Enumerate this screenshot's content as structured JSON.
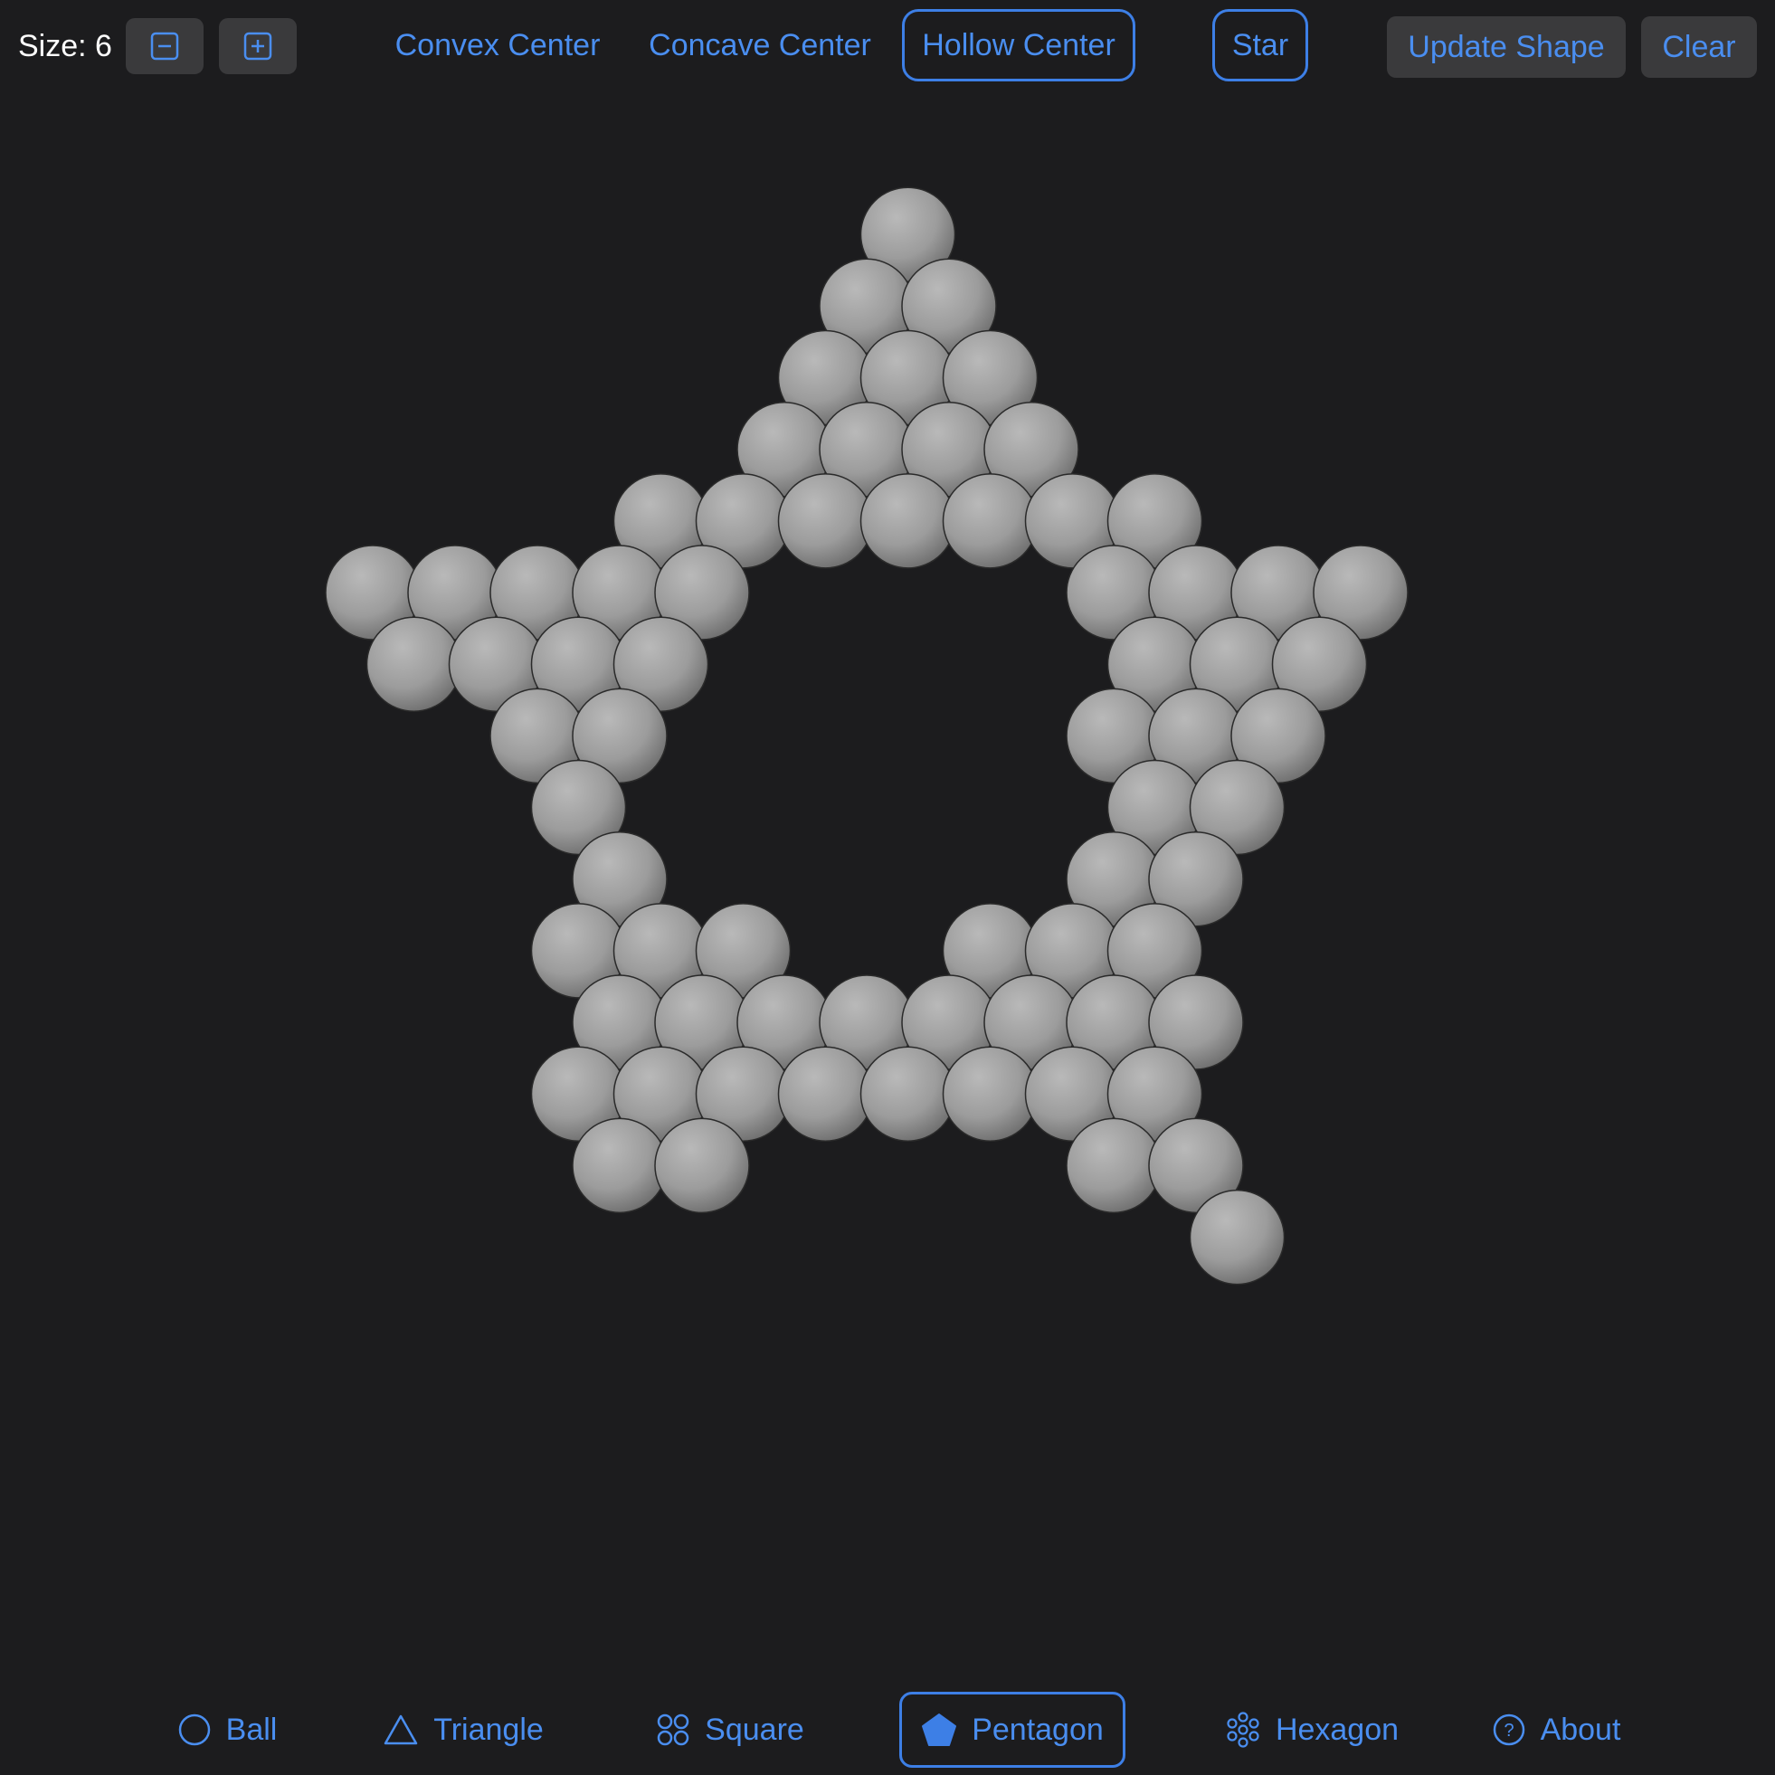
{
  "toolbar": {
    "size_label": "Size: 6",
    "decrease_icon": "minus-square-icon",
    "increase_icon": "plus-square-icon",
    "buttons": {
      "convex": "Convex Center",
      "concave": "Concave Center",
      "hollow": "Hollow Center",
      "star": "Star",
      "update": "Update Shape",
      "clear": "Clear"
    },
    "selected": [
      "Hollow Center",
      "Star"
    ]
  },
  "viewport": {
    "shape": "pentagon star, hollow center",
    "ball_color": "#9a9a9a",
    "background": "#1c1c1e"
  },
  "tabs": [
    {
      "label": "Ball",
      "icon": "circle-icon"
    },
    {
      "label": "Triangle",
      "icon": "triangle-icon"
    },
    {
      "label": "Square",
      "icon": "four-circles-icon"
    },
    {
      "label": "Pentagon",
      "icon": "pentagon-icon",
      "selected": true
    },
    {
      "label": "Hexagon",
      "icon": "hexagon-circles-icon"
    },
    {
      "label": "About",
      "icon": "question-circle-icon"
    }
  ],
  "colors": {
    "accent": "#4a8ef0",
    "accent_border": "#3d7fe6",
    "button_bg": "#3a3a3c",
    "background": "#1c1c1e",
    "text": "#ffffff"
  }
}
